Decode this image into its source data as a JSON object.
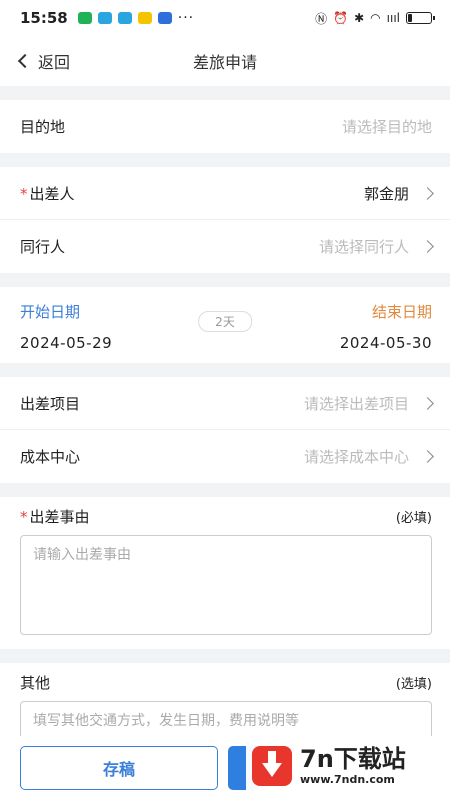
{
  "status_bar": {
    "time": "15:58",
    "app_icons": [
      {
        "name": "app-icon-1",
        "color": "#1fb356"
      },
      {
        "name": "app-icon-2",
        "color": "#2aa5e0"
      },
      {
        "name": "app-icon-3",
        "color": "#2aa5e0"
      },
      {
        "name": "app-icon-4",
        "color": "#f5c400"
      },
      {
        "name": "app-icon-5",
        "color": "#2f6fdc"
      }
    ],
    "dots": "···",
    "signal_text": "ıııl",
    "battery_level": 0.2
  },
  "navbar": {
    "back_label": "返回",
    "title": "差旅申请"
  },
  "form": {
    "destination": {
      "label": "目的地",
      "placeholder": "请选择目的地"
    },
    "traveler": {
      "required_mark": "*",
      "label": "出差人",
      "value": "郭金朋"
    },
    "companion": {
      "label": "同行人",
      "placeholder": "请选择同行人"
    },
    "dates": {
      "start_label": "开始日期",
      "end_label": "结束日期",
      "start_value": "2024-05-29",
      "end_value": "2024-05-30",
      "days": "2天"
    },
    "project": {
      "label": "出差项目",
      "placeholder": "请选择出差项目"
    },
    "cost_center": {
      "label": "成本中心",
      "placeholder": "请选择成本中心"
    },
    "reason": {
      "required_mark": "*",
      "label": "出差事由",
      "hint": "(必填)",
      "placeholder": "请输入出差事由"
    },
    "other": {
      "label": "其他",
      "hint": "(选填)",
      "placeholder": "填写其他交通方式，发生日期，费用说明等"
    }
  },
  "bottom": {
    "draft_label": "存稿"
  },
  "watermark": {
    "name": "7n下载站",
    "url": "www.7ndn.com"
  },
  "colors": {
    "accent_blue": "#3b7fd9",
    "accent_orange": "#e08a3c",
    "required_red": "#e64340"
  }
}
